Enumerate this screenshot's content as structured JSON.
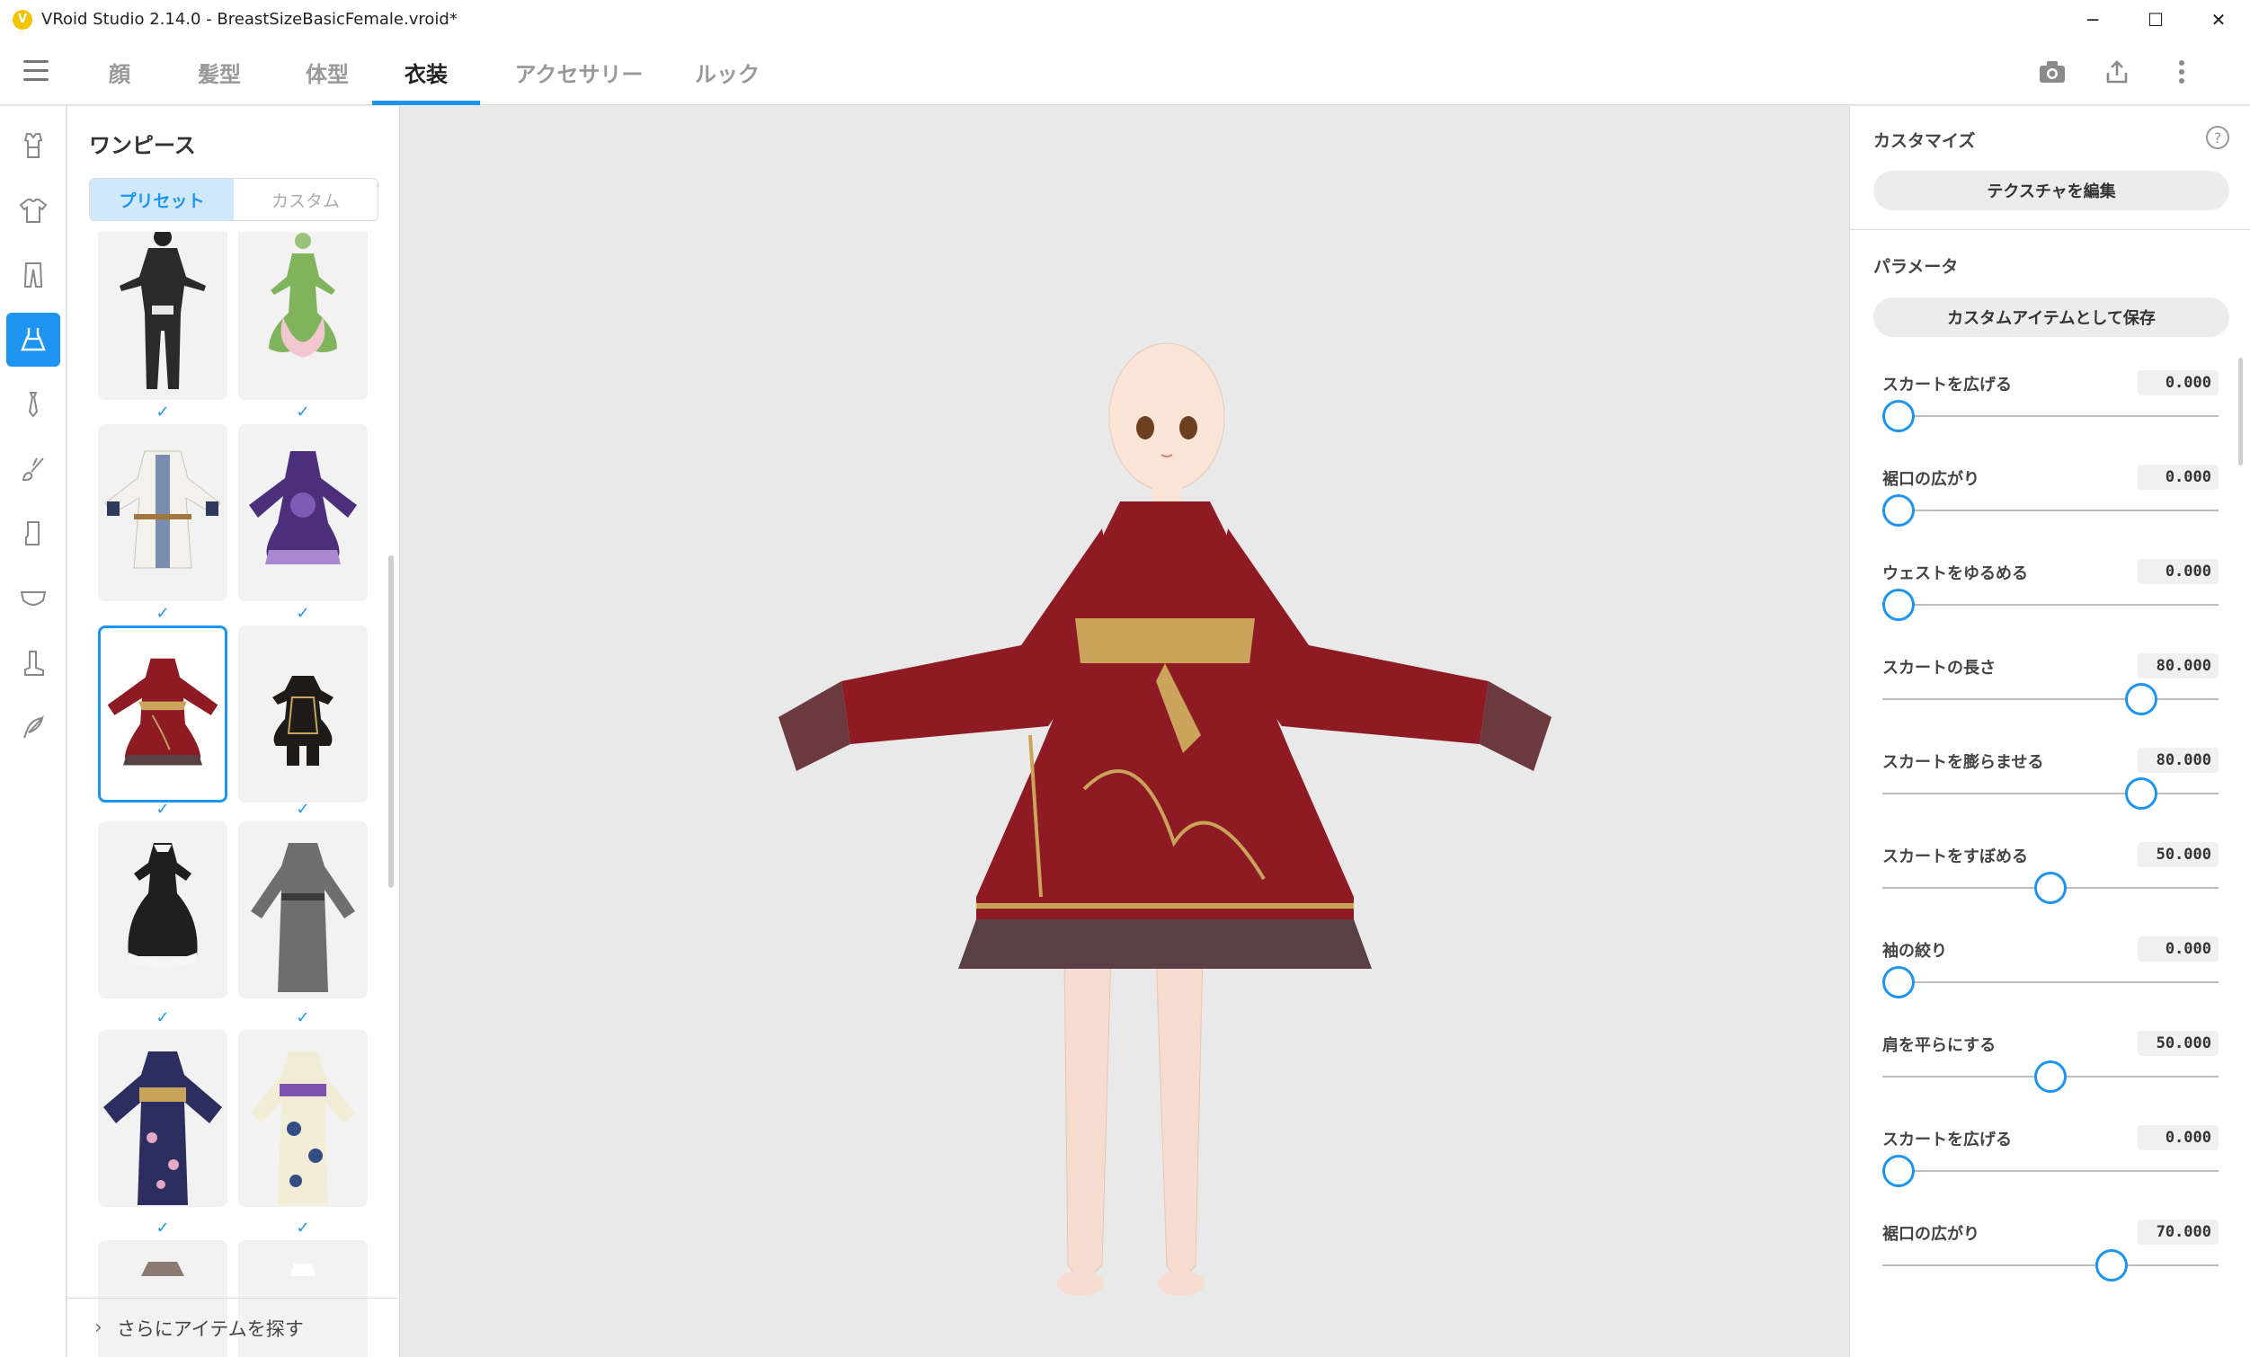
{
  "window": {
    "title": "VRoid Studio 2.14.0 - BreastSizeBasicFemale.vroid*",
    "logo_letter": "V",
    "minimize": "─",
    "maximize": "☐",
    "close": "✕"
  },
  "nav": {
    "tabs": [
      {
        "label": "顔"
      },
      {
        "label": "髪型"
      },
      {
        "label": "体型"
      },
      {
        "label": "衣装"
      },
      {
        "label": "アクセサリー"
      },
      {
        "label": "ルック"
      }
    ],
    "active_tab": 3,
    "actions": [
      "camera-icon",
      "export-icon",
      "more-vertical-icon"
    ]
  },
  "rail": {
    "items": [
      "shirt-tucked-icon",
      "tshirt-icon",
      "pants-icon",
      "onepiece-icon",
      "tie-icon",
      "brush-icon",
      "socks-icon",
      "bra-icon",
      "boot-icon",
      "feather-icon"
    ],
    "active_index": 3
  },
  "panel": {
    "title": "ワンピース",
    "segments": [
      "プリセット",
      "カスタム"
    ],
    "active_segment": 0,
    "check_mark": "✓",
    "more_chevron": "›",
    "more_label": "さらにアイテムを探す"
  },
  "presets": [
    {
      "name": "black-bodysuit",
      "checked": true
    },
    {
      "name": "green-pink-flower-dress",
      "checked": true
    },
    {
      "name": "white-sailor-coat-dress",
      "checked": true
    },
    {
      "name": "purple-lolita-dress",
      "checked": true
    },
    {
      "name": "red-china-dress",
      "checked": true,
      "selected": true
    },
    {
      "name": "black-gold-short-dress",
      "checked": true
    },
    {
      "name": "black-maid-dress",
      "checked": true
    },
    {
      "name": "gray-long-robe",
      "checked": true
    },
    {
      "name": "navy-floral-yukata",
      "checked": true
    },
    {
      "name": "cream-floral-yukata",
      "checked": true
    },
    {
      "name": "partial-item-1",
      "checked": false
    },
    {
      "name": "partial-item-2",
      "checked": false
    }
  ],
  "customize": {
    "title": "カスタマイズ",
    "help": "?",
    "edit_texture": "テクスチャを編集"
  },
  "parameters": {
    "title": "パラメータ",
    "save_custom": "カスタムアイテムとして保存",
    "items": [
      {
        "label": "スカートを広げる",
        "value": "0.000",
        "fraction": 0.0
      },
      {
        "label": "裾口の広がり",
        "value": "0.000",
        "fraction": 0.0
      },
      {
        "label": "ウェストをゆるめる",
        "value": "0.000",
        "fraction": 0.0
      },
      {
        "label": "スカートの長さ",
        "value": "80.000",
        "fraction": 0.8
      },
      {
        "label": "スカートを膨らませる",
        "value": "80.000",
        "fraction": 0.8
      },
      {
        "label": "スカートをすぼめる",
        "value": "50.000",
        "fraction": 0.5
      },
      {
        "label": "袖の絞り",
        "value": "0.000",
        "fraction": 0.0
      },
      {
        "label": "肩を平らにする",
        "value": "50.000",
        "fraction": 0.5
      },
      {
        "label": "スカートを広げる",
        "value": "0.000",
        "fraction": 0.0
      },
      {
        "label": "裾口の広がり",
        "value": "70.000",
        "fraction": 0.7
      }
    ]
  },
  "colors": {
    "accent": "#1d95f0",
    "dress_red": "#8e1a24",
    "gold": "#c9a45a",
    "skin": "#f6dccb",
    "petticoat": "#5a3f44"
  }
}
